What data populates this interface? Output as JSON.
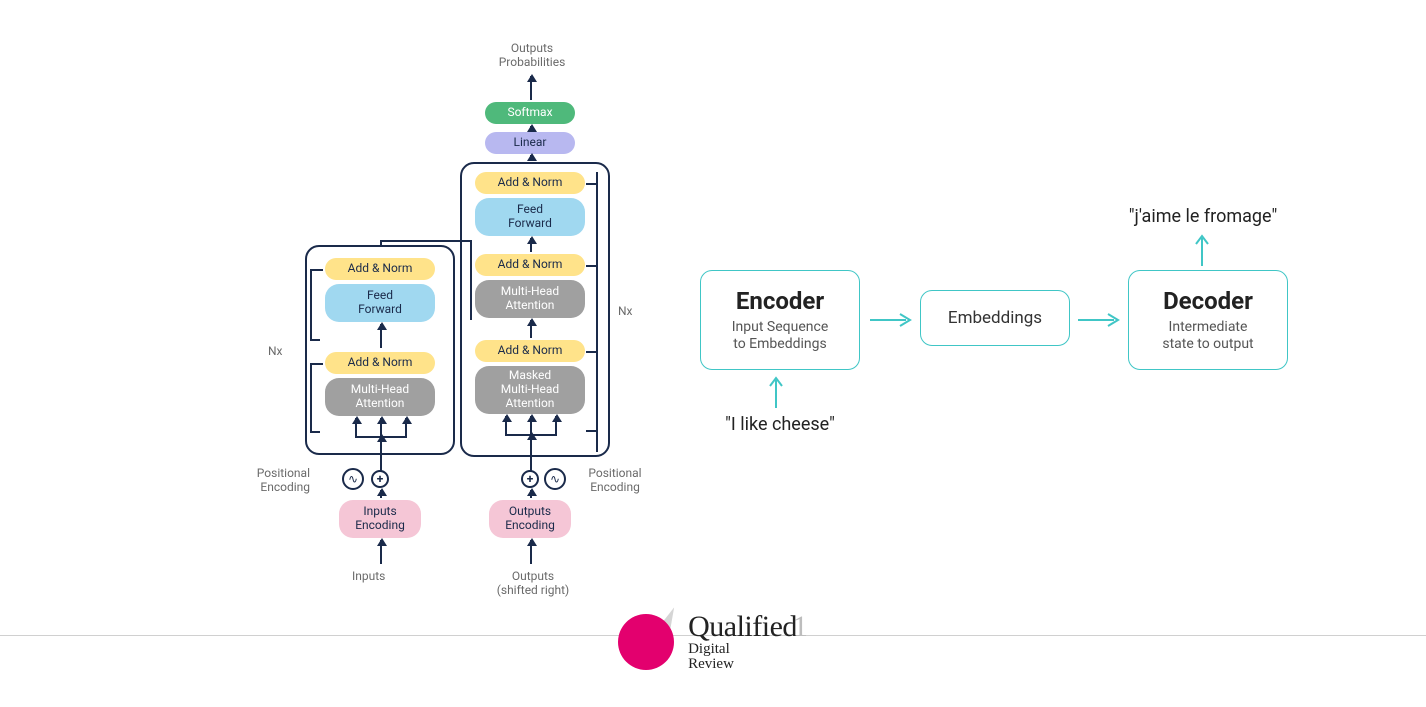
{
  "transformer": {
    "outputs_prob_top": "Outputs",
    "outputs_prob_bottom": "Probabilities",
    "softmax": "Softmax",
    "linear": "Linear",
    "addnorm": "Add & Norm",
    "feedforward": "Feed\nForward",
    "mha": "Multi-Head\nAttention",
    "mmha": "Masked\nMulti-Head\nAttention",
    "inputs_enc": "Inputs\nEncoding",
    "outputs_enc": "Outputs\nEncoding",
    "inputs_label": "Inputs",
    "outputs_label_1": "Outputs",
    "outputs_label_2": "(shifted right)",
    "pos_enc": "Positional\nEncoding",
    "nx": "Nx"
  },
  "cartoon": {
    "encoder_title": "Encoder",
    "encoder_sub": "Input Sequence\nto Embeddings",
    "embeddings": "Embeddings",
    "decoder_title": "Decoder",
    "decoder_sub": "Intermediate\nstate to output",
    "input_text": "\"I like cheese\"",
    "output_text": "\"j'aime le fromage\""
  },
  "footer": {
    "brand": "Qualified",
    "num": "1",
    "line1": "Digital",
    "line2": "Review"
  }
}
